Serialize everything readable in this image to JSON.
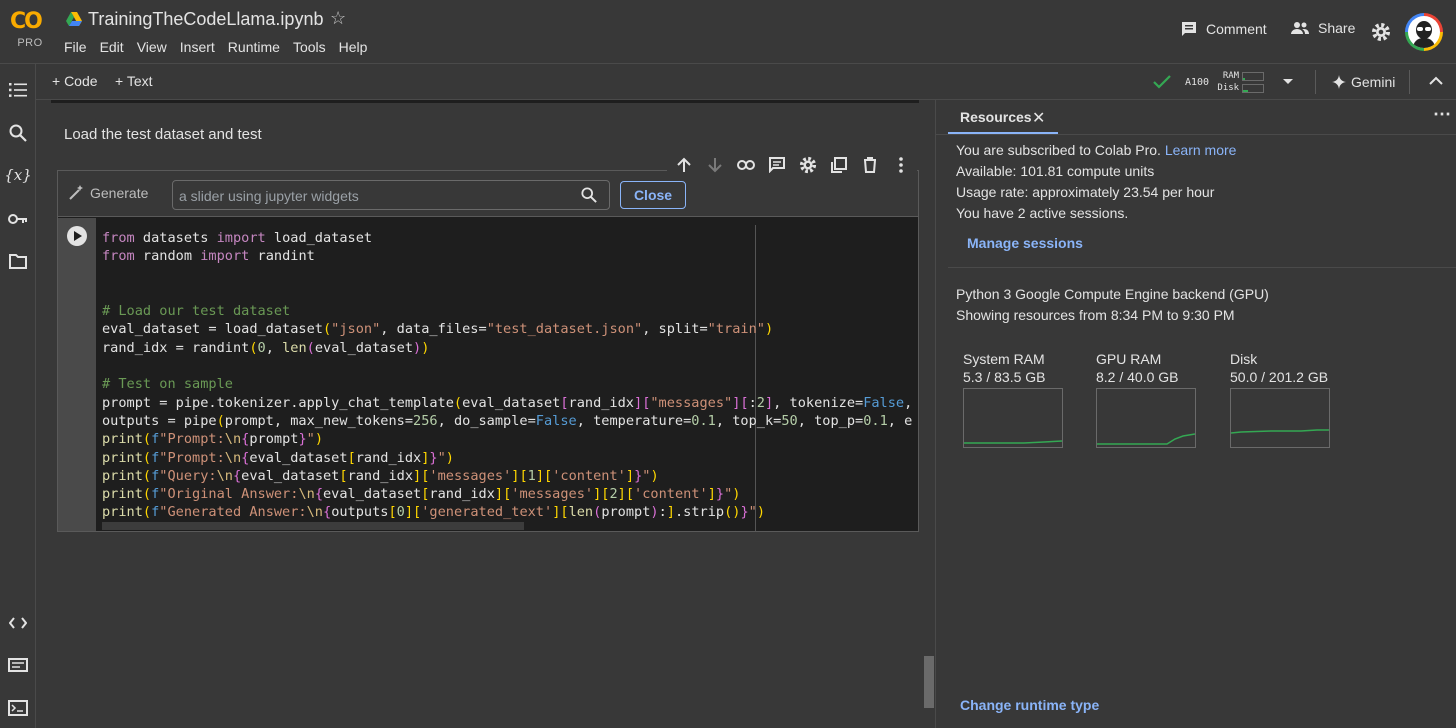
{
  "app": {
    "logo_text": "CO",
    "logo_badge": "PRO",
    "doc_title": "TrainingTheCodeLlama.ipynb"
  },
  "menu": [
    "File",
    "Edit",
    "View",
    "Insert",
    "Runtime",
    "Tools",
    "Help"
  ],
  "header_actions": {
    "comment": "Comment",
    "share": "Share"
  },
  "toolbar": {
    "add_code": "+ Code",
    "add_text": "+ Text",
    "runtime": "A100",
    "ram_label": "RAM",
    "disk_label": "Disk",
    "gemini": "Gemini",
    "connected": true
  },
  "notebook": {
    "text_cell": "Load the test dataset and test",
    "generate": {
      "button": "Generate",
      "placeholder": "a slider using jupyter widgets",
      "close": "Close"
    },
    "code_lines": [
      "from datasets import load_dataset",
      "from random import randint",
      "",
      "",
      "# Load our test dataset",
      "eval_dataset = load_dataset(\"json\", data_files=\"test_dataset.json\", split=\"train\")",
      "rand_idx = randint(0, len(eval_dataset))",
      "",
      "# Test on sample",
      "prompt = pipe.tokenizer.apply_chat_template(eval_dataset[rand_idx][\"messages\"][:2], tokenize=False,",
      "outputs = pipe(prompt, max_new_tokens=256, do_sample=False, temperature=0.1, top_k=50, top_p=0.1, e",
      "print(f\"Prompt:\\n{prompt}\")",
      "print(f\"Prompt:\\n{eval_dataset[rand_idx]}\")",
      "print(f\"Query:\\n{eval_dataset[rand_idx]['messages'][1]['content']}\")",
      "print(f\"Original Answer:\\n{eval_dataset[rand_idx]['messages'][2]['content']}\")",
      "print(f\"Generated Answer:\\n{outputs[0]['generated_text'][len(prompt):].strip()}\")"
    ]
  },
  "resources": {
    "tab": "Resources",
    "subscribed_prefix": "You are subscribed to Colab Pro.",
    "learn_more": "Learn more",
    "available": "Available: 101.81 compute units",
    "usage": "Usage rate: approximately 23.54 per hour",
    "sessions": "You have 2 active sessions.",
    "manage_sessions": "Manage sessions",
    "backend": "Python 3 Google Compute Engine backend (GPU)",
    "showing": "Showing resources from 8:34 PM to 9:30 PM",
    "gauges": [
      {
        "label": "System RAM",
        "value": "5.3 / 83.5 GB",
        "used": 5.3,
        "total": 83.5
      },
      {
        "label": "GPU RAM",
        "value": "8.2 / 40.0 GB",
        "used": 8.2,
        "total": 40.0
      },
      {
        "label": "Disk",
        "value": "50.0 / 201.2 GB",
        "used": 50.0,
        "total": 201.2
      }
    ],
    "change_runtime": "Change runtime type",
    "accent_color": "#8ab4f8",
    "usage_color": "#34a853"
  }
}
